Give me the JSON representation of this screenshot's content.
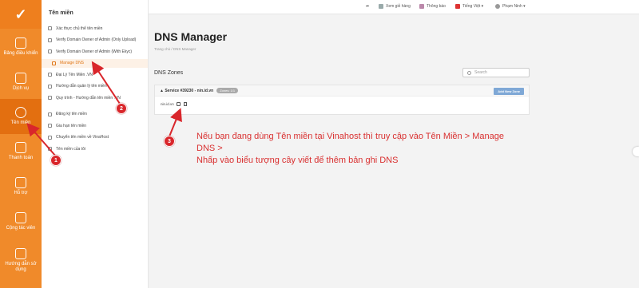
{
  "rail": {
    "items": [
      {
        "label": "Bảng điều khiển"
      },
      {
        "label": "Dịch vụ"
      },
      {
        "label": "Tên miền"
      },
      {
        "label": "Thanh toán"
      },
      {
        "label": "Hỗ trợ"
      },
      {
        "label": "Cộng tác viên"
      },
      {
        "label": "Hướng dẫn sử dụng"
      }
    ]
  },
  "sidebar": {
    "title": "Tên miền",
    "items": [
      {
        "label": "Xác thực chủ thể tên miền"
      },
      {
        "label": "Verify Domain Owner of Admin (Only Upload)"
      },
      {
        "label": "Verify Domain Owner of Admin (With Ekyc)"
      },
      {
        "label": "Manage DNS"
      },
      {
        "label": "Đại Lý Tên Miền .VN"
      },
      {
        "label": "Hướng dẫn quản lý tên miền"
      },
      {
        "label": "Quy trình - Hướng dẫn tên miền .VN"
      },
      {
        "label": "Đăng ký tên miền"
      },
      {
        "label": "Gia hạn tên miền"
      },
      {
        "label": "Chuyển tên miền về VinaHost"
      },
      {
        "label": "Tên miền của tôi"
      }
    ]
  },
  "topbar": {
    "cart": "Xem giỏ hàng",
    "notifications": "Thông báo",
    "language": "Tiếng Việt",
    "user": "Phạm Ninh"
  },
  "main": {
    "title": "DNS Manager",
    "breadcrumb": "Trang chủ  /  DNS Manager",
    "zones_label": "DNS Zones",
    "search_placeholder": "Search",
    "service_title": "Service #39230 - nin.id.vn",
    "service_badge": "Zones: 1/1",
    "add_zone": "Add New Zone",
    "zone_name": "nin.id.vn"
  },
  "instruction": {
    "line1": "Nếu bạn đang dùng Tên miền tại Vinahost thì truy cập vào Tên Miền > Manage DNS >",
    "line2": "Nhấp vào biểu tượng cây viết để thêm bản ghi DNS"
  },
  "annotations": {
    "step1": "1",
    "step2": "2",
    "step3": "3",
    "arrow_color": "#d9262b"
  },
  "colors": {
    "rail": "#f08a2a",
    "accent": "#e0781a",
    "instruction": "#d93030"
  }
}
